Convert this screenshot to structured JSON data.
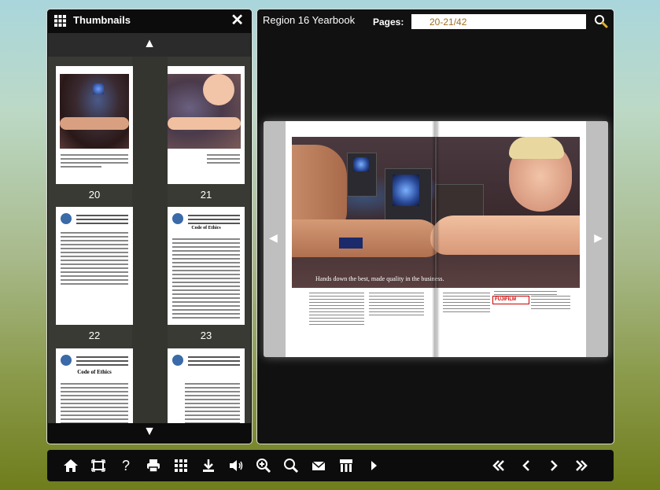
{
  "thumbnails": {
    "title": "Thumbnails",
    "close_symbol": "✕",
    "scroll_up_symbol": "▲",
    "scroll_down_symbol": "▼",
    "items": [
      {
        "label": "20"
      },
      {
        "label": "21"
      },
      {
        "label": "22"
      },
      {
        "label": "23"
      },
      {
        "label": ""
      },
      {
        "label": ""
      }
    ],
    "page_text": {
      "page20_caption": "Hands down the best, made quality in the business.",
      "page23_heading": "Code of Ethics",
      "page24_heading": "Code of Ethics"
    }
  },
  "viewer": {
    "book_title": "Region 16 Yearbook",
    "pages_label": "Pages:",
    "pages_value": "20-21/42",
    "prev_symbol": "◀",
    "next_symbol": "▶",
    "spread_caption": "Hands down the best, made quality in the business.",
    "ad_logo": "FUJIFILM"
  },
  "toolbar": {
    "left_tools": [
      "home-icon",
      "fit-screen-icon",
      "help-icon",
      "print-icon",
      "thumbnails-icon",
      "download-icon",
      "sound-icon",
      "zoom-in-icon",
      "search-icon",
      "email-icon",
      "social-share-icon",
      "autoplay-icon"
    ],
    "right_tools": [
      "first-page-icon",
      "previous-page-icon",
      "next-page-icon",
      "last-page-icon"
    ],
    "help_glyph": "?"
  },
  "colors": {
    "panel_bg": "#0c0c0c",
    "page_number_text": "#a07020",
    "accent_white": "#ffffff"
  }
}
